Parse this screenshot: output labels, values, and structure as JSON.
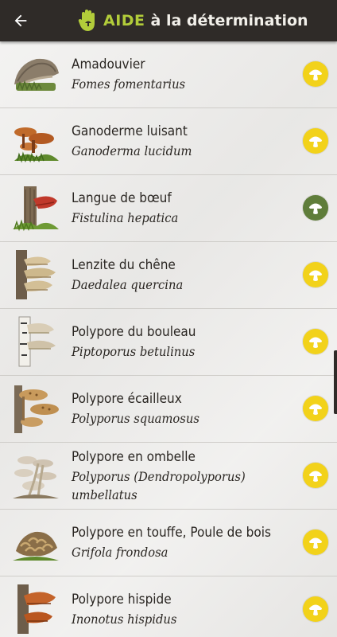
{
  "header": {
    "back_label": "←",
    "title_highlight": "AIDE",
    "title_rest": "à la détermination",
    "accent_color": "#b2cc3a",
    "background_color": "#2f2b28"
  },
  "items": [
    {
      "name": "Amadouvier",
      "latin": "Fomes fomentarius",
      "latin_line2": "",
      "badge_color": "#f2d21a",
      "badge_icon": "mushroom-icon"
    },
    {
      "name": "Ganoderme luisant",
      "latin": "Ganoderma lucidum",
      "latin_line2": "",
      "badge_color": "#f2d21a",
      "badge_icon": "mushroom-icon"
    },
    {
      "name": "Langue de bœuf",
      "latin": "Fistulina hepatica",
      "latin_line2": "",
      "badge_color": "#5f7d3a",
      "badge_icon": "mushroom-icon"
    },
    {
      "name": "Lenzite du chêne",
      "latin": "Daedalea quercina",
      "latin_line2": "",
      "badge_color": "#f2d21a",
      "badge_icon": "mushroom-icon"
    },
    {
      "name": "Polypore du bouleau",
      "latin": "Piptoporus betulinus",
      "latin_line2": "",
      "badge_color": "#f2d21a",
      "badge_icon": "mushroom-icon"
    },
    {
      "name": "Polypore écailleux",
      "latin": "Polyporus squamosus",
      "latin_line2": "",
      "badge_color": "#f2d21a",
      "badge_icon": "mushroom-icon"
    },
    {
      "name": "Polypore en ombelle",
      "latin": "Polyporus (Dendropolyporus)",
      "latin_line2": "umbellatus",
      "badge_color": "#f2d21a",
      "badge_icon": "mushroom-icon"
    },
    {
      "name": "Polypore en touffe, Poule de bois",
      "latin": "Grifola frondosa",
      "latin_line2": "",
      "badge_color": "#f2d21a",
      "badge_icon": "mushroom-icon"
    },
    {
      "name": "Polypore hispide",
      "latin": "Inonotus hispidus",
      "latin_line2": "",
      "badge_color": "#f2d21a",
      "badge_icon": "mushroom-icon"
    }
  ]
}
